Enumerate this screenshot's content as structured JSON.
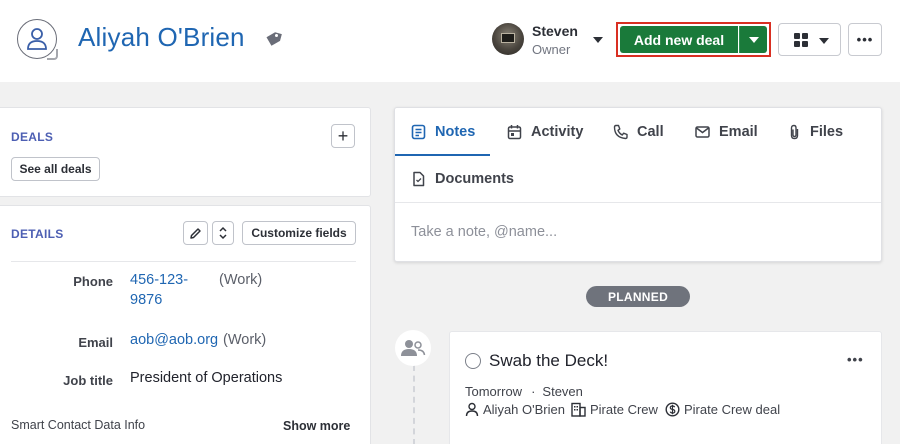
{
  "header": {
    "person_name": "Aliyah O'Brien",
    "owner_name": "Steven",
    "owner_role": "Owner",
    "add_deal_label": "Add new deal"
  },
  "deals": {
    "title": "DEALS",
    "see_all_label": "See all deals"
  },
  "details": {
    "title": "DETAILS",
    "customize_label": "Customize fields",
    "fields": [
      {
        "label": "Phone",
        "value_line1": "456-123-",
        "value_line2": "9876",
        "type": "(Work)"
      },
      {
        "label": "Email",
        "value": "aob@aob.org",
        "type": "(Work)"
      },
      {
        "label": "Job title",
        "value": "President of Operations"
      }
    ],
    "smart_data_label": "Smart Contact Data Info",
    "show_more_label": "Show more"
  },
  "composer": {
    "tabs": [
      {
        "label": "Notes",
        "icon": "notes-icon",
        "active": true
      },
      {
        "label": "Activity",
        "icon": "calendar-icon"
      },
      {
        "label": "Call",
        "icon": "phone-icon"
      },
      {
        "label": "Email",
        "icon": "mail-icon"
      },
      {
        "label": "Files",
        "icon": "paperclip-icon"
      },
      {
        "label": "Documents",
        "icon": "document-icon"
      }
    ],
    "placeholder": "Take a note, @name..."
  },
  "timeline": {
    "planned_label": "PLANNED",
    "activity": {
      "title": "Swab the Deck!",
      "when": "Tomorrow",
      "separator": "·",
      "assignee": "Steven",
      "contact": "Aliyah O'Brien",
      "organization": "Pirate Crew",
      "deal": "Pirate Crew deal"
    }
  },
  "colors": {
    "primary_link": "#1f66b2",
    "add_deal_green": "#1a7a3a",
    "highlight_red": "#d92f22",
    "section_title": "#4d5fb3"
  }
}
